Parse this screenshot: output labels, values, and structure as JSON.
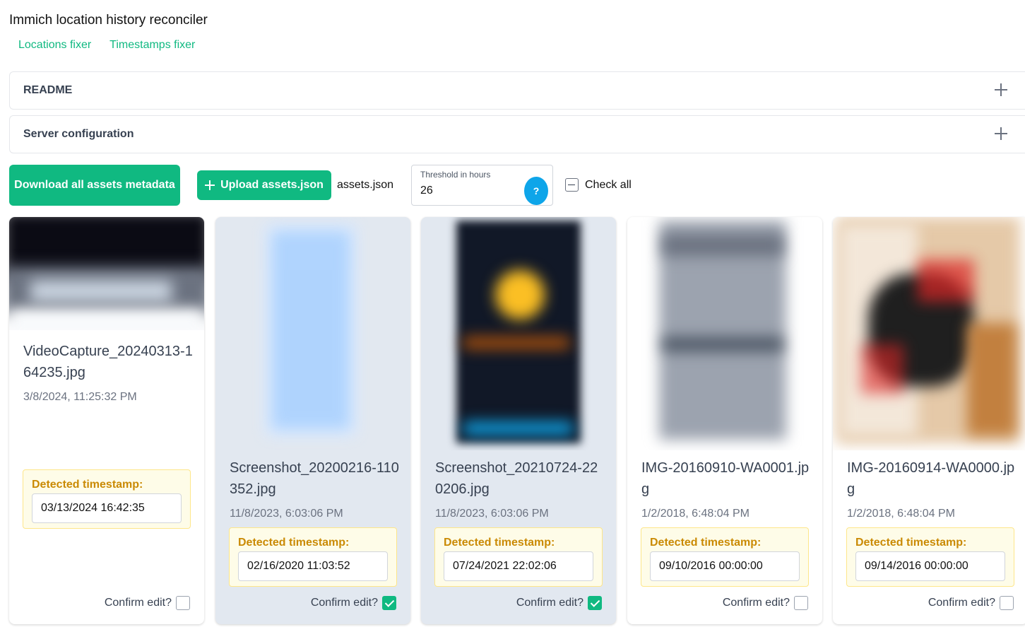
{
  "app": {
    "title": "Immich location history reconciler"
  },
  "nav": [
    {
      "label": "Locations fixer"
    },
    {
      "label": "Timestamps fixer"
    }
  ],
  "accordions": [
    {
      "title": "README",
      "icon": "plus-icon"
    },
    {
      "title": "Server configuration",
      "icon": "plus-icon"
    }
  ],
  "toolbar": {
    "download_label": "Download all assets metadata",
    "upload_label": "Upload assets.json",
    "uploaded_file": "assets.json",
    "threshold_label": "Threshold in hours",
    "threshold_value": "26",
    "help_label": "?",
    "check_all_label": "Check all"
  },
  "colors": {
    "accent": "#10b981",
    "help": "#0ea5e9",
    "warning_text": "#ca8a04",
    "warning_bg": "#fefce8"
  },
  "cards": [
    {
      "filename": "VideoCapture_20240313-164235.jpg",
      "date": "3/8/2024, 11:25:32 PM",
      "detected_label": "Detected timestamp:",
      "detected_value": "03/13/2024 16:42:35",
      "confirm_label": "Confirm edit?",
      "confirmed": false
    },
    {
      "filename": "Screenshot_20200216-110352.jpg",
      "date": "11/8/2023, 6:03:06 PM",
      "detected_label": "Detected timestamp:",
      "detected_value": "02/16/2020 11:03:52",
      "confirm_label": "Confirm edit?",
      "confirmed": true
    },
    {
      "filename": "Screenshot_20210724-220206.jpg",
      "date": "11/8/2023, 6:03:06 PM",
      "detected_label": "Detected timestamp:",
      "detected_value": "07/24/2021 22:02:06",
      "confirm_label": "Confirm edit?",
      "confirmed": true
    },
    {
      "filename": "IMG-20160910-WA0001.jpg",
      "date": "1/2/2018, 6:48:04 PM",
      "detected_label": "Detected timestamp:",
      "detected_value": "09/10/2016 00:00:00",
      "confirm_label": "Confirm edit?",
      "confirmed": false
    },
    {
      "filename": "IMG-20160914-WA0000.jpg",
      "date": "1/2/2018, 6:48:04 PM",
      "detected_label": "Detected timestamp:",
      "detected_value": "09/14/2016 00:00:00",
      "confirm_label": "Confirm edit?",
      "confirmed": false
    }
  ]
}
